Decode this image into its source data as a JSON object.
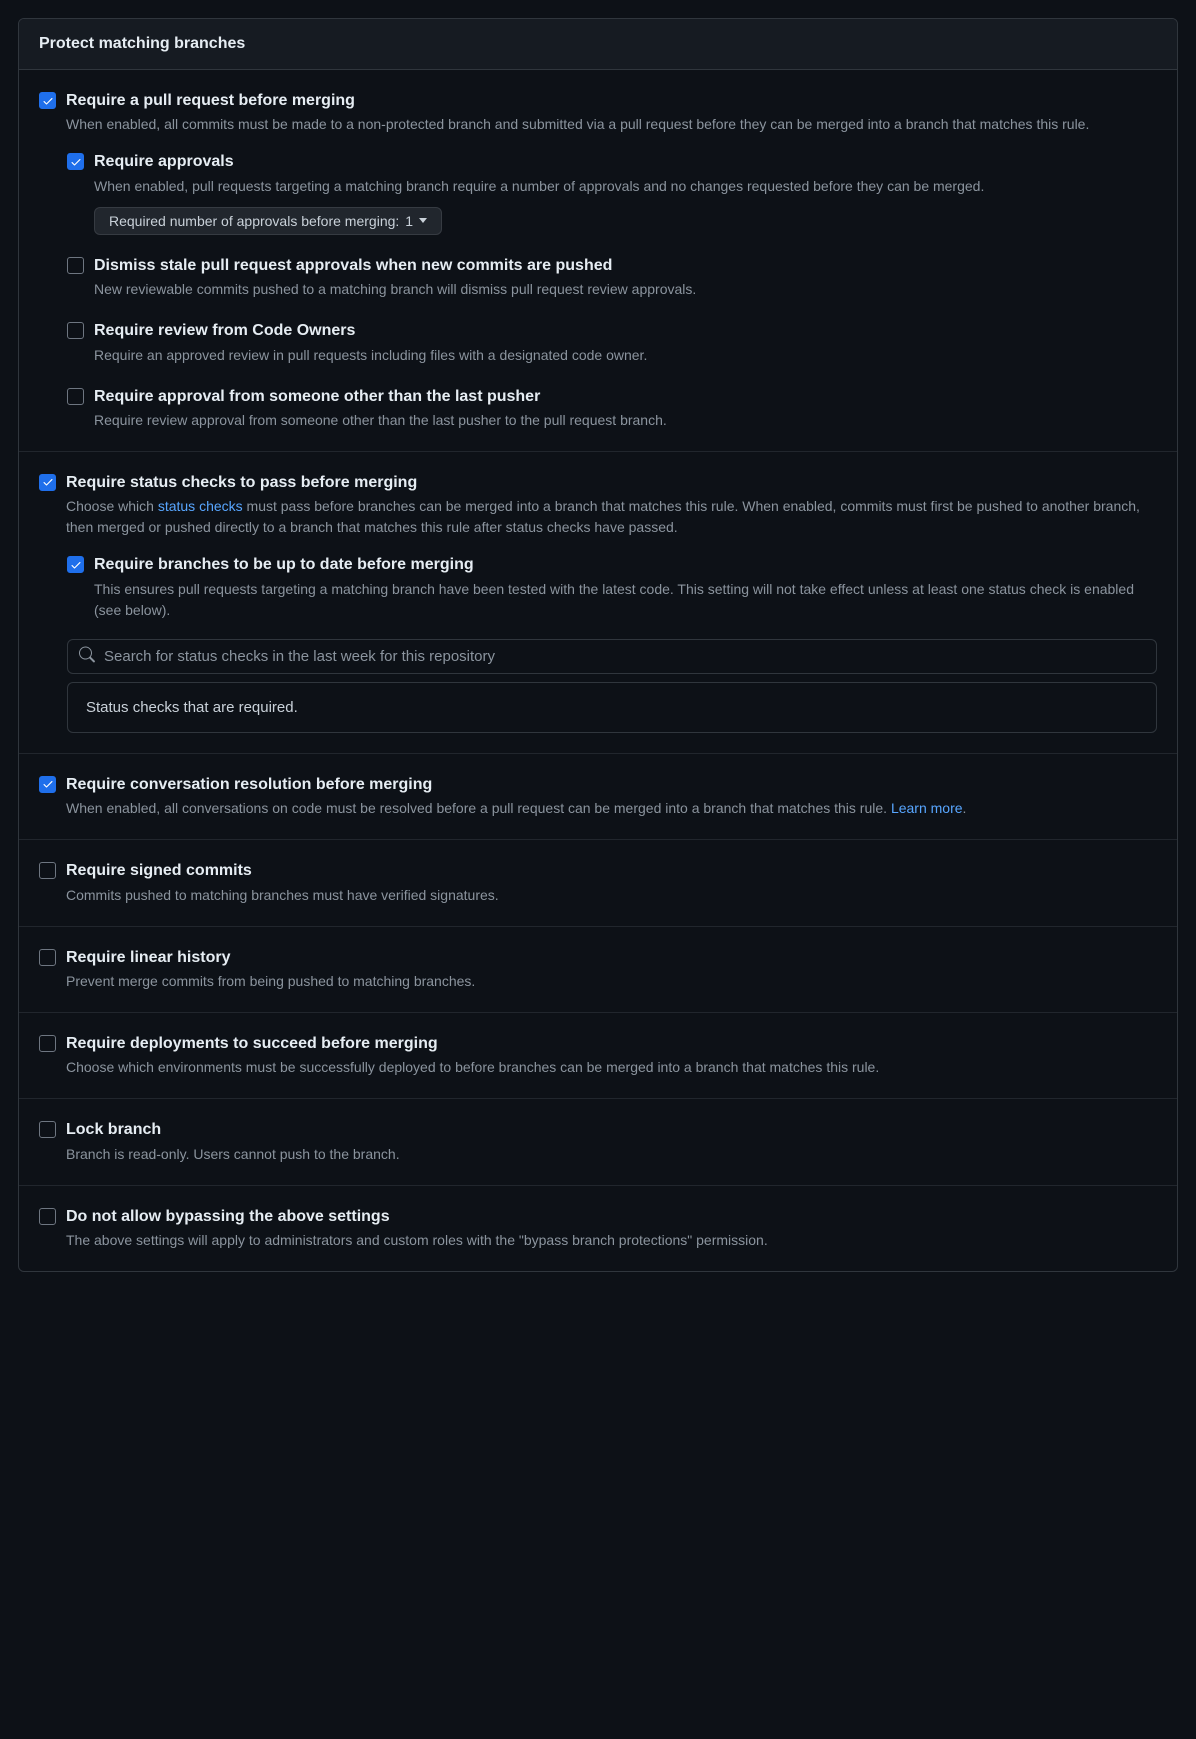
{
  "header": "Protect matching branches",
  "search": {
    "placeholder": "Search for status checks in the last week for this repository"
  },
  "status_required_label": "Status checks that are required.",
  "approvals_select": {
    "label": "Required number of approvals before merging:",
    "value": "1"
  },
  "pr": {
    "title": "Require a pull request before merging",
    "desc": "When enabled, all commits must be made to a non-protected branch and submitted via a pull request before they can be merged into a branch that matches this rule."
  },
  "approvals": {
    "title": "Require approvals",
    "desc": "When enabled, pull requests targeting a matching branch require a number of approvals and no changes requested before they can be merged."
  },
  "dismiss": {
    "title": "Dismiss stale pull request approvals when new commits are pushed",
    "desc": "New reviewable commits pushed to a matching branch will dismiss pull request review approvals."
  },
  "codeowners": {
    "title": "Require review from Code Owners",
    "desc": "Require an approved review in pull requests including files with a designated code owner."
  },
  "otherpusher": {
    "title": "Require approval from someone other than the last pusher",
    "desc": "Require review approval from someone other than the last pusher to the pull request branch."
  },
  "status": {
    "title": "Require status checks to pass before merging",
    "desc_pre": "Choose which ",
    "desc_link": "status checks",
    "desc_post": " must pass before branches can be merged into a branch that matches this rule. When enabled, commits must first be pushed to another branch, then merged or pushed directly to a branch that matches this rule after status checks have passed."
  },
  "uptodate": {
    "title": "Require branches to be up to date before merging",
    "desc": "This ensures pull requests targeting a matching branch have been tested with the latest code. This setting will not take effect unless at least one status check is enabled (see below)."
  },
  "conversation": {
    "title": "Require conversation resolution before merging",
    "desc": "When enabled, all conversations on code must be resolved before a pull request can be merged into a branch that matches this rule. ",
    "learn": "Learn more"
  },
  "signed": {
    "title": "Require signed commits",
    "desc": "Commits pushed to matching branches must have verified signatures."
  },
  "linear": {
    "title": "Require linear history",
    "desc": "Prevent merge commits from being pushed to matching branches."
  },
  "deploy": {
    "title": "Require deployments to succeed before merging",
    "desc": "Choose which environments must be successfully deployed to before branches can be merged into a branch that matches this rule."
  },
  "lock": {
    "title": "Lock branch",
    "desc": "Branch is read-only. Users cannot push to the branch."
  },
  "bypass": {
    "title": "Do not allow bypassing the above settings",
    "desc": "The above settings will apply to administrators and custom roles with the \"bypass branch protections\" permission."
  }
}
